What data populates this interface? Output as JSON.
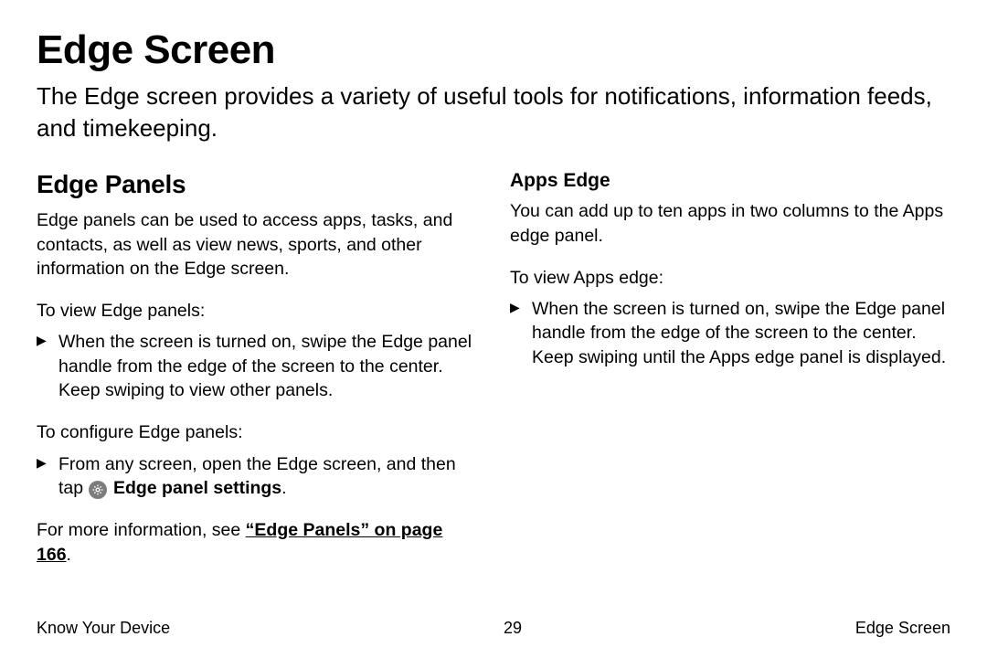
{
  "title": "Edge Screen",
  "intro": "The Edge screen provides a variety of useful tools for notifications, information feeds, and timekeeping.",
  "left": {
    "heading": "Edge Panels",
    "body": "Edge panels can be used to access apps, tasks, and contacts, as well as view news, sports, and other information on the Edge screen.",
    "view_lead": "To view Edge panels:",
    "view_step": "When the screen is turned on, swipe the Edge panel handle from the edge of the screen to the center. Keep swiping to view other panels.",
    "config_lead": "To configure Edge panels:",
    "config_step_pre": "From any screen, open the Edge screen, and then tap ",
    "config_setting_label": "Edge panel settings",
    "config_step_post": ".",
    "more_pre": "For more information, see ",
    "more_link": "“Edge Panels” on page 166",
    "more_post": "."
  },
  "right": {
    "heading": "Apps Edge",
    "body": "You can add up to ten apps in two columns to the Apps edge panel.",
    "view_lead": "To view Apps edge:",
    "view_step": "When the screen is turned on, swipe the Edge panel handle from the edge of the screen to the center. Keep swiping until the Apps edge panel is displayed."
  },
  "footer": {
    "left": "Know Your Device",
    "center": "29",
    "right": "Edge Screen"
  }
}
